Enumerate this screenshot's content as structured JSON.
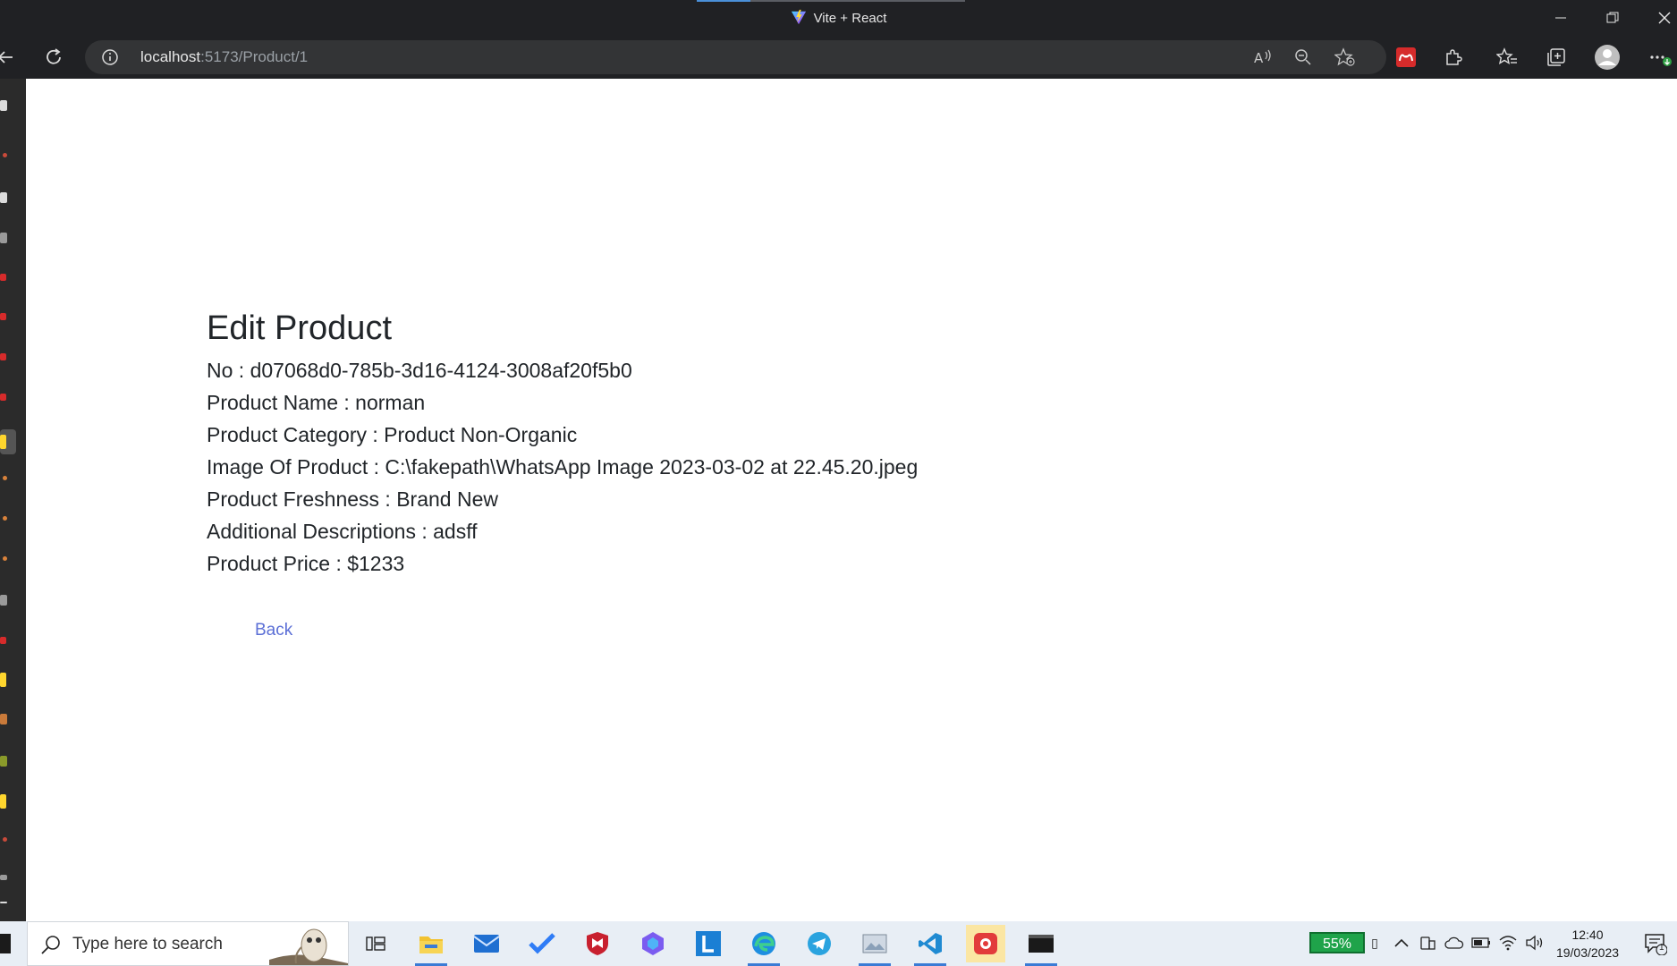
{
  "window": {
    "title": "Vite + React"
  },
  "browser": {
    "url_host": "localhost",
    "url_rest": ":5173/Product/1"
  },
  "product": {
    "heading": "Edit Product",
    "fields": [
      "No : d07068d0-785b-3d16-4124-3008af20f5b0",
      "Product Name : norman",
      "Product Category : Product Non-Organic",
      "Image Of Product : C:\\fakepath\\WhatsApp Image 2023-03-02 at 22.45.20.jpeg",
      "Product Freshness : Brand New",
      "Additional Descriptions : adsff",
      "Product Price : $1233"
    ],
    "back_label": "Back"
  },
  "taskbar": {
    "search_placeholder": "Type here to search",
    "battery": "55%",
    "time": "12:40",
    "date": "19/03/2023",
    "notification_count": "1"
  }
}
